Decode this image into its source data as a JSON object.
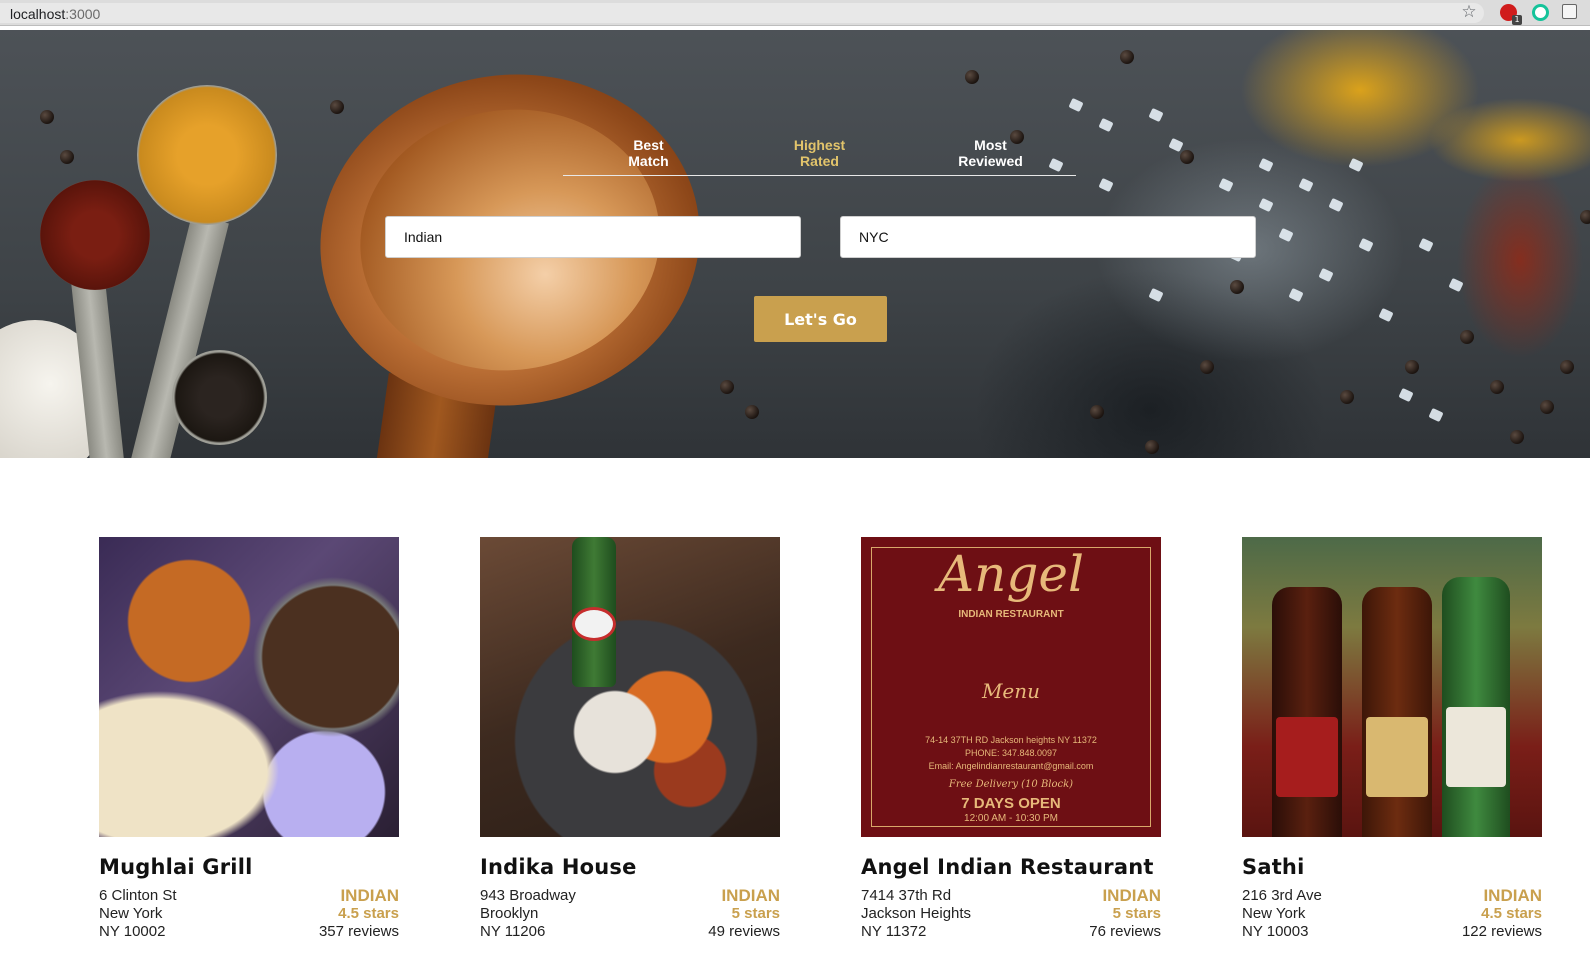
{
  "browser": {
    "url_host": "localhost",
    "url_port": ":3000",
    "extension_badge": "1"
  },
  "sort_tabs": [
    {
      "line1": "Best",
      "line2": "Match"
    },
    {
      "line1": "Highest",
      "line2": "Rated"
    },
    {
      "line1": "Most",
      "line2": "Reviewed"
    }
  ],
  "active_tab": "Highest Rated",
  "search": {
    "term_value": "Indian",
    "location_value": "NYC"
  },
  "go_button_label": "Let's Go",
  "colors": {
    "accent": "#c9a04e",
    "active_tab": "#e2c46b"
  },
  "businesses": [
    {
      "name": "Mughlai Grill",
      "address": "6 Clinton St",
      "city": "New York",
      "state_zip": "NY 10002",
      "category": "INDIAN",
      "rating": "4.5 stars",
      "reviews": "357 reviews"
    },
    {
      "name": "Indika House",
      "address": "943 Broadway",
      "city": "Brooklyn",
      "state_zip": "NY 11206",
      "category": "INDIAN",
      "rating": "5 stars",
      "reviews": "49 reviews"
    },
    {
      "name": "Angel Indian Restaurant",
      "address": "7414 37th Rd",
      "city": "Jackson Heights",
      "state_zip": "NY 11372",
      "category": "INDIAN",
      "rating": "5 stars",
      "reviews": "76 reviews"
    },
    {
      "name": "Sathi",
      "address": "216 3rd Ave",
      "city": "New York",
      "state_zip": "NY 10003",
      "category": "INDIAN",
      "rating": "4.5 stars",
      "reviews": "122 reviews"
    }
  ],
  "image_texts": {
    "angel_logo": "Angel",
    "angel_sub": "INDIAN    RESTAURANT",
    "angel_menu": "Menu",
    "angel_addr": "74-14 37TH RD Jackson heights NY 11372",
    "angel_phone": "PHONE: 347.848.0097",
    "angel_email": "Email: Angelindianrestaurant@gmail.com",
    "angel_delivery": "Free Delivery (10 Block)",
    "angel_open": "7 DAYS OPEN",
    "angel_hours": "12:00 AM - 10:30 PM"
  }
}
